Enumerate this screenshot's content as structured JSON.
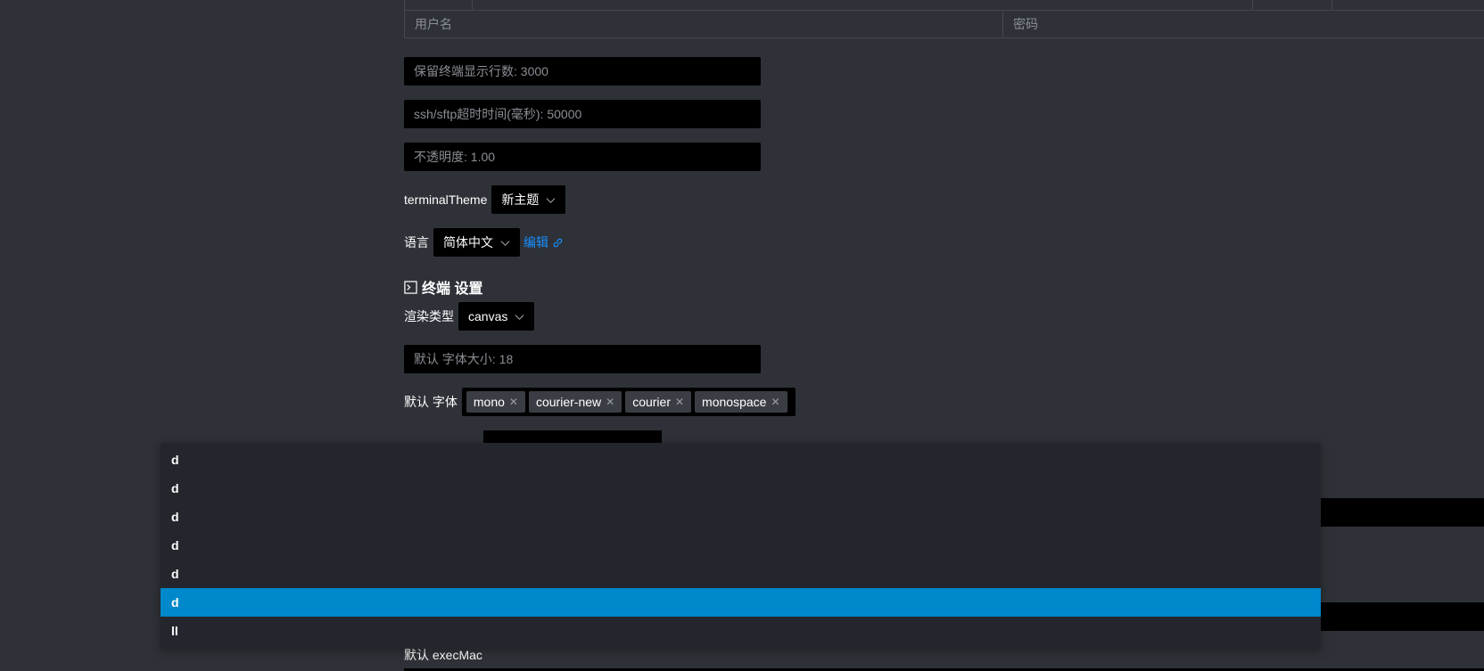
{
  "credentials": {
    "username_placeholder": "用户名",
    "password_placeholder": "密码"
  },
  "inputs": {
    "terminal_lines": "保留终端显示行数: 3000",
    "ssh_timeout": "ssh/sftp超时时间(毫秒): 50000",
    "opacity": "不透明度: 1.00",
    "font_size": "默认 字体大小: 18"
  },
  "theme": {
    "label": "terminalTheme",
    "value": "新主题"
  },
  "language": {
    "label": "语言",
    "value": "简体中文",
    "edit_link": "编辑"
  },
  "terminal_section": {
    "title": "终端 设置",
    "render_label": "渲染类型",
    "render_value": "canvas",
    "font_label": "默认 字体",
    "fonts": [
      "mono",
      "courier-new",
      "courier",
      "monospace"
    ]
  },
  "exec": {
    "label": "默认 execMac"
  },
  "dropdown": {
    "items": [
      "d",
      "d",
      "d",
      "d",
      "d",
      "d",
      "ll"
    ],
    "active_index": 5
  },
  "colors": {
    "background": "#2e3238",
    "input_bg": "#000000",
    "dropdown_bg": "#23262c",
    "active": "#0088cc",
    "link": "#1890ff"
  }
}
